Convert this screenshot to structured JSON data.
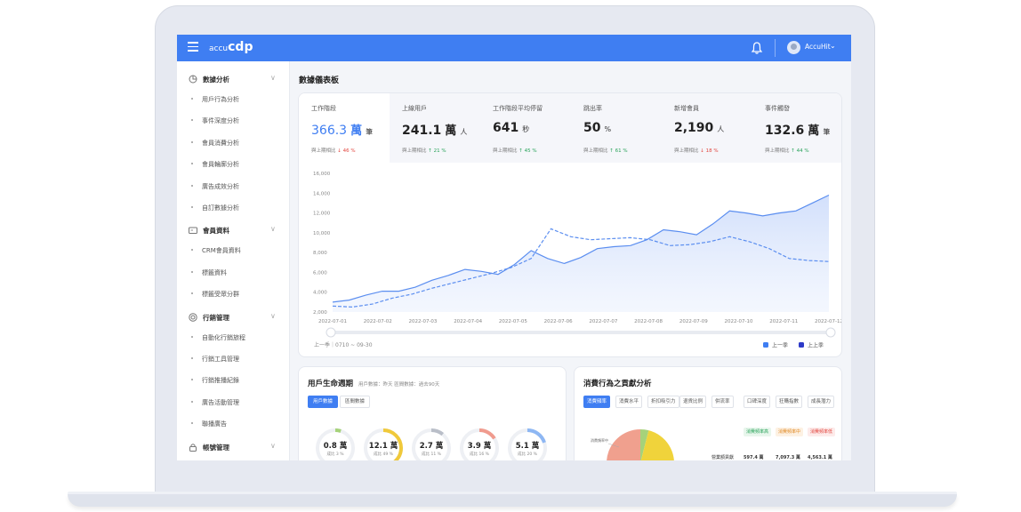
{
  "app": {
    "brand_prefix": "accu",
    "brand_name": "cdp",
    "user_name": "AccuHit"
  },
  "colors": {
    "primary": "#3f7ef2",
    "navy": "#2e3ac8",
    "up": "#29a35a",
    "down": "#e2463f"
  },
  "sidebar": {
    "groups": [
      {
        "label": "數據分析",
        "icon": "pie-chart-icon",
        "items": [
          "用戶行為分析",
          "事件深度分析",
          "會員消費分析",
          "會員輪廓分析",
          "廣告成效分析",
          "自訂數據分析"
        ]
      },
      {
        "label": "會員資料",
        "icon": "id-card-icon",
        "items": [
          "CRM會員資料",
          "標籤資料",
          "標籤受眾分群"
        ]
      },
      {
        "label": "行銷管理",
        "icon": "target-icon",
        "items": [
          "自動化行銷旅程",
          "行銷工具管理",
          "行銷推播紀錄",
          "廣告活動管理",
          "聯播廣告"
        ]
      },
      {
        "label": "帳號管理",
        "icon": "lock-icon",
        "items": []
      }
    ]
  },
  "page": {
    "title": "數據儀表板"
  },
  "kpis": [
    {
      "label": "工作階段",
      "value": "366.3",
      "unit": "萬",
      "unit2": "筆",
      "compare": "與上期相比",
      "delta": "46 %",
      "dir": "down"
    },
    {
      "label": "上線用戶",
      "value": "241.1",
      "unit": "萬",
      "unit2": "人",
      "compare": "與上期相比",
      "delta": "21 %",
      "dir": "up"
    },
    {
      "label": "工作階段平均停留",
      "value": "641",
      "unit": "",
      "unit2": "秒",
      "compare": "與上期相比",
      "delta": "45 %",
      "dir": "up"
    },
    {
      "label": "跳出率",
      "value": "50",
      "unit": "",
      "unit2": "%",
      "compare": "與上期相比",
      "delta": "61 %",
      "dir": "up"
    },
    {
      "label": "新增會員",
      "value": "2,190",
      "unit": "",
      "unit2": "人",
      "compare": "與上期相比",
      "delta": "18 %",
      "dir": "down"
    },
    {
      "label": "事件觸發",
      "value": "132.6",
      "unit": "萬",
      "unit2": "筆",
      "compare": "與上期相比",
      "delta": "44 %",
      "dir": "up"
    }
  ],
  "chart_data": {
    "type": "area",
    "x": [
      "2022-07-01",
      "2022-07-02",
      "2022-07-03",
      "2022-07-04",
      "2022-07-05",
      "2022-07-06",
      "2022-07-07",
      "2022-07-08",
      "2022-07-09",
      "2022-07-10",
      "2022-07-11",
      "2022-07-12"
    ],
    "x_fine": [
      0,
      0.6,
      1,
      1.6,
      2,
      2.5,
      3,
      3.5,
      4,
      4.5,
      5,
      5.5,
      6,
      6.5,
      7,
      7.5,
      8,
      8.5,
      9,
      9.5,
      10,
      10.5,
      11,
      11.5,
      12
    ],
    "series": [
      {
        "name": "上一季",
        "style": "solid",
        "values": [
          3000,
          3200,
          3700,
          4100,
          4100,
          4500,
          5200,
          5700,
          6300,
          6100,
          5800,
          6800,
          8200,
          7400,
          6900,
          7500,
          8400,
          8600,
          8700,
          9300,
          10300,
          10100,
          9800,
          10900,
          12200,
          12000,
          11700,
          12000,
          12200,
          13000,
          13800
        ]
      },
      {
        "name": "上上季",
        "style": "dashed",
        "values": [
          2600,
          2500,
          2800,
          3400,
          3800,
          4400,
          4900,
          5400,
          5900,
          6500,
          7400,
          10400,
          9600,
          9300,
          9400,
          9500,
          9300,
          8700,
          8800,
          9100,
          9600,
          9100,
          8400,
          7400,
          7200,
          7100
        ]
      }
    ],
    "ylim": [
      2000,
      16000
    ],
    "yticks": [
      "16,000",
      "14,000",
      "12,000",
      "10,000",
      "8,000",
      "6,000",
      "4,000",
      "2,000"
    ],
    "range_label": "上一季｜0710 ~ 09-30",
    "legend": [
      "上一季",
      "上上季"
    ]
  },
  "lifecycle": {
    "title": "用戶生命週期",
    "subtitle": "用戶數據：昨天  區間數據：過去90天",
    "tabs": [
      "用戶數據",
      "區間數據"
    ],
    "rings": [
      {
        "value": "0.8 萬",
        "compare": "成比 3 %",
        "color": "#a6d27a",
        "pct": 0.05
      },
      {
        "value": "12.1 萬",
        "compare": "成比 49 %",
        "color": "#f0c93b",
        "pct": 0.49
      },
      {
        "value": "2.7 萬",
        "compare": "成比 11 %",
        "color": "#b9bec8",
        "pct": 0.11
      },
      {
        "value": "3.9 萬",
        "compare": "成比 16 %",
        "color": "#f09b8e",
        "pct": 0.16
      },
      {
        "value": "5.1 萬",
        "compare": "成比 20 %",
        "color": "#8eb7f3",
        "pct": 0.2
      }
    ]
  },
  "contribution": {
    "title": "消費行為之貢獻分析",
    "tabs": [
      "消費頻率",
      "消費水平",
      "折扣吸引力",
      "退貨比例",
      "併流率",
      "口碑深度",
      "狂購指數",
      "成長潛力"
    ],
    "tags": [
      {
        "label": "消費頻率高",
        "color": "#29a35a",
        "bg": "#e8f6ec"
      },
      {
        "label": "消費頻率中",
        "color": "#e08a25",
        "bg": "#fdf1e3"
      },
      {
        "label": "消費頻率低",
        "color": "#e2463f",
        "bg": "#fdebea"
      }
    ],
    "row_label": "營業額貢獻",
    "row_values": [
      "597.4 萬",
      "7,097.3 萬",
      "4,563.1 萬"
    ],
    "pie_note": "消費頻率中"
  }
}
